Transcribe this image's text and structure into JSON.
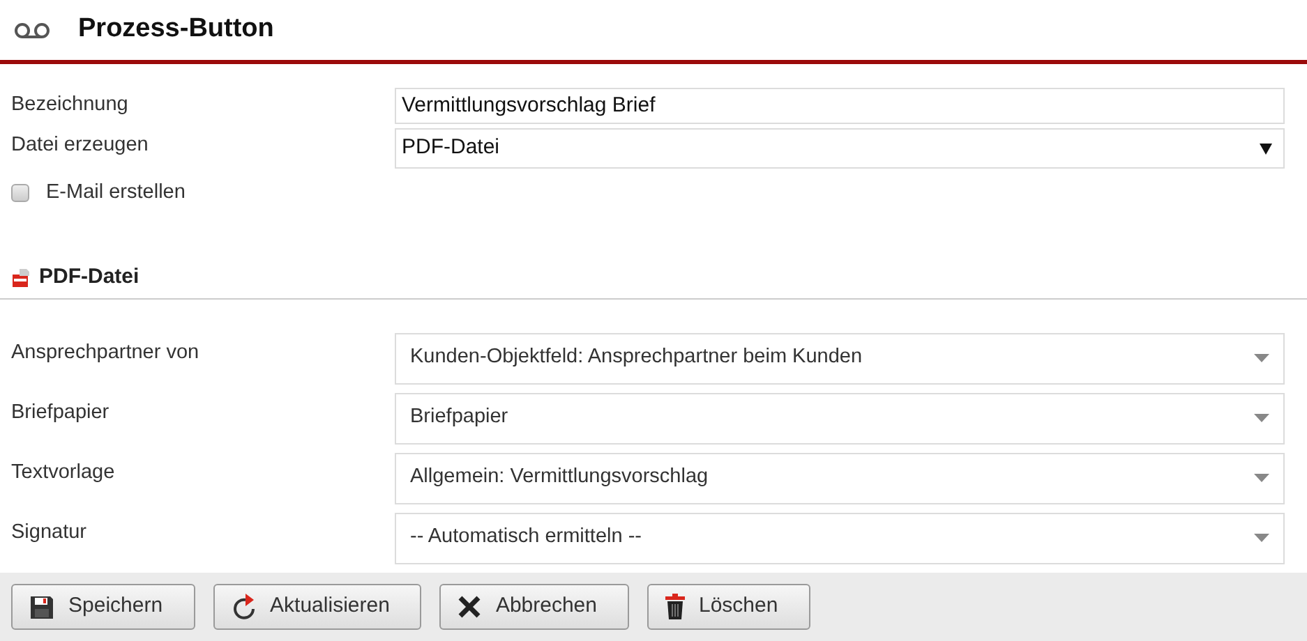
{
  "header": {
    "title": "Prozess-Button"
  },
  "fields": [
    {
      "kind": "text",
      "label": "Bezeichnung",
      "value": "Vermittlungsvorschlag Brief"
    },
    {
      "kind": "select",
      "label": "Datei erzeugen",
      "value": "PDF-Datei"
    }
  ],
  "email_checkbox": {
    "label": "E-Mail erstellen",
    "checked": false
  },
  "section": {
    "title": "PDF-Datei",
    "fields": [
      {
        "label": "Ansprechpartner von",
        "value": "Kunden-Objektfeld: Ansprechpartner beim Kunden"
      },
      {
        "label": "Briefpapier",
        "value": "Briefpapier"
      },
      {
        "label": "Textvorlage",
        "value": "Allgemein: Vermittlungsvorschlag"
      },
      {
        "label": "Signatur",
        "value": "-- Automatisch ermitteln --"
      }
    ]
  },
  "buttons": [
    {
      "kind": "save",
      "label": "Speichern"
    },
    {
      "kind": "refresh",
      "label": "Aktualisieren"
    },
    {
      "kind": "cancel",
      "label": "Abbrechen"
    },
    {
      "kind": "delete",
      "label": "Löschen"
    }
  ]
}
